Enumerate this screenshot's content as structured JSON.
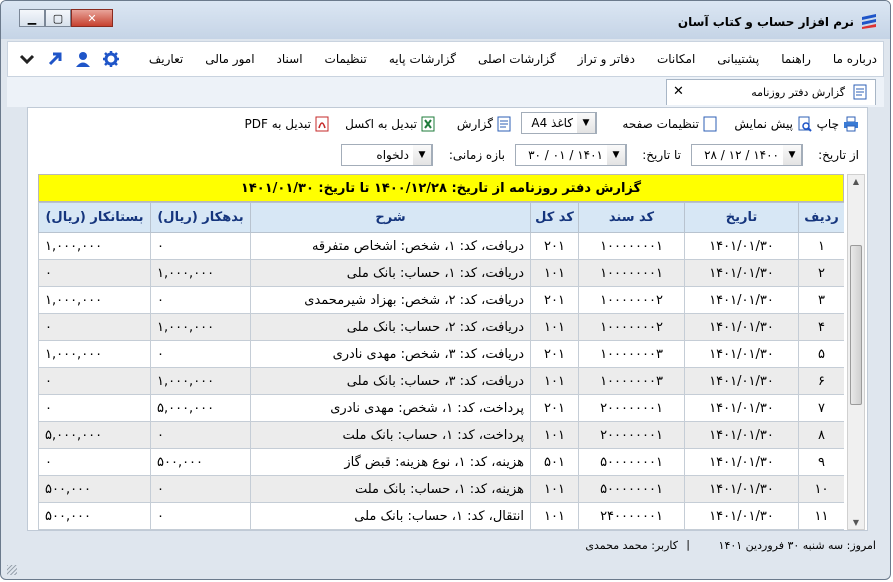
{
  "window": {
    "title": "نرم افزار حساب و کتاب آسان"
  },
  "menu": {
    "items": [
      "تعاریف",
      "امور مالی",
      "اسناد",
      "تنظیمات",
      "گزارشات پایه",
      "گزارشات اصلی",
      "دفاتر و تراز",
      "امکانات",
      "پشتیبانی",
      "راهنما",
      "درباره ما"
    ]
  },
  "tab": {
    "label": "گزارش دفتر روزنامه"
  },
  "toolbar": {
    "print": "چاپ",
    "preview": "پیش نمایش",
    "page_settings": "تنظیمات صفحه",
    "paper_value": "کاغذ A4",
    "report": "گزارش",
    "to_excel": "تبدیل به اکسل",
    "to_pdf": "تبدیل به PDF"
  },
  "filter": {
    "from_label": "از تاریخ:",
    "from_value": "۱۴۰۰ / ۱۲ / ۲۸",
    "to_label": "تا تاریخ:",
    "to_value": "۱۴۰۱ / ۰۱ / ۳۰",
    "period_label": "بازه زمانی:",
    "period_value": "دلخواه"
  },
  "report": {
    "banner": "گزارش دفتر روزنامه از تاریخ: ۱۴۰۰/۱۲/۲۸  تا تاریخ: ۱۴۰۱/۰۱/۳۰",
    "columns": [
      "ردیف",
      "تاریخ",
      "کد سند",
      "کد کل",
      "شرح",
      "بدهکار (ریال)",
      "بستانکار (ریال)"
    ],
    "rows": [
      [
        "۱",
        "۱۴۰۱/۰۱/۳۰",
        "۱۰۰۰۰۰۰۰۱",
        "۲۰۱",
        "دریافت، کد: ۱، شخص: اشخاص متفرقه",
        "۰",
        "۱,۰۰۰,۰۰۰"
      ],
      [
        "۲",
        "۱۴۰۱/۰۱/۳۰",
        "۱۰۰۰۰۰۰۰۱",
        "۱۰۱",
        "دریافت، کد: ۱، حساب: بانک ملی",
        "۱,۰۰۰,۰۰۰",
        "۰"
      ],
      [
        "۳",
        "۱۴۰۱/۰۱/۳۰",
        "۱۰۰۰۰۰۰۰۲",
        "۲۰۱",
        "دریافت، کد: ۲، شخص: بهزاد شیرمحمدی",
        "۰",
        "۱,۰۰۰,۰۰۰"
      ],
      [
        "۴",
        "۱۴۰۱/۰۱/۳۰",
        "۱۰۰۰۰۰۰۰۲",
        "۱۰۱",
        "دریافت، کد: ۲، حساب: بانک ملی",
        "۱,۰۰۰,۰۰۰",
        "۰"
      ],
      [
        "۵",
        "۱۴۰۱/۰۱/۳۰",
        "۱۰۰۰۰۰۰۰۳",
        "۲۰۱",
        "دریافت، کد: ۳، شخص: مهدی نادری",
        "۰",
        "۱,۰۰۰,۰۰۰"
      ],
      [
        "۶",
        "۱۴۰۱/۰۱/۳۰",
        "۱۰۰۰۰۰۰۰۳",
        "۱۰۱",
        "دریافت، کد: ۳، حساب: بانک ملی",
        "۱,۰۰۰,۰۰۰",
        "۰"
      ],
      [
        "۷",
        "۱۴۰۱/۰۱/۳۰",
        "۲۰۰۰۰۰۰۰۱",
        "۲۰۱",
        "پرداخت، کد: ۱، شخص: مهدی نادری",
        "۵,۰۰۰,۰۰۰",
        "۰"
      ],
      [
        "۸",
        "۱۴۰۱/۰۱/۳۰",
        "۲۰۰۰۰۰۰۰۱",
        "۱۰۱",
        "پرداخت، کد: ۱، حساب: بانک ملت",
        "۰",
        "۵,۰۰۰,۰۰۰"
      ],
      [
        "۹",
        "۱۴۰۱/۰۱/۳۰",
        "۵۰۰۰۰۰۰۰۱",
        "۵۰۱",
        "هزینه، کد: ۱، نوع هزینه: قبض گاز",
        "۵۰۰,۰۰۰",
        "۰"
      ],
      [
        "۱۰",
        "۱۴۰۱/۰۱/۳۰",
        "۵۰۰۰۰۰۰۰۱",
        "۱۰۱",
        "هزینه، کد: ۱، حساب: بانک ملت",
        "۰",
        "۵۰۰,۰۰۰"
      ],
      [
        "۱۱",
        "۱۴۰۱/۰۱/۳۰",
        "۲۴۰۰۰۰۰۰۱",
        "۱۰۱",
        "انتقال، کد: ۱، حساب: بانک ملی",
        "۰",
        "۵۰۰,۰۰۰"
      ]
    ]
  },
  "status": {
    "date": "امروز: سه شنبه ۳۰ فروردین ۱۴۰۱",
    "separator": "|",
    "user": "کاربر: محمد محمدی"
  },
  "colors": {
    "banner": "#ffff00",
    "header_bg": "#d7e7f5",
    "header_text": "#15357d",
    "accent": "#1f55c8"
  }
}
